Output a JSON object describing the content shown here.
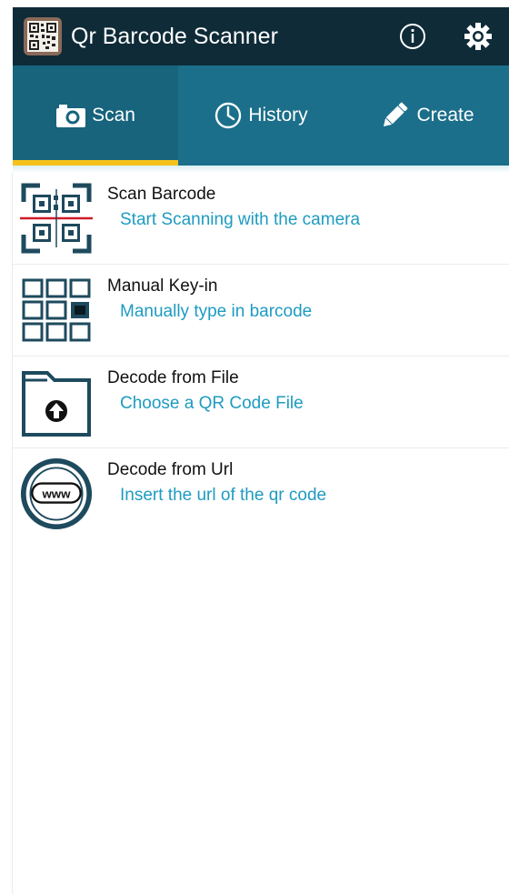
{
  "app": {
    "title": "Qr Barcode Scanner",
    "icons": {
      "app_logo": "qr-code-logo-icon",
      "info": "info-icon",
      "settings": "gear-icon"
    }
  },
  "tabs": [
    {
      "label": "Scan",
      "icon": "camera-icon",
      "active": true
    },
    {
      "label": "History",
      "icon": "clock-icon",
      "active": false
    },
    {
      "label": "Create",
      "icon": "pencil-icon",
      "active": false
    }
  ],
  "colors": {
    "app_bar": "#0f2b38",
    "tab_bar": "#1b6f8a",
    "tab_indicator": "#f4c21b",
    "subtitle": "#1e9bc0",
    "icon_dark": "#1e4a5e"
  },
  "items": [
    {
      "title": "Scan Barcode",
      "subtitle": "Start Scanning with the camera",
      "icon": "qr-scan-icon"
    },
    {
      "title": "Manual Key-in",
      "subtitle": "Manually type in barcode",
      "icon": "keypad-icon"
    },
    {
      "title": "Decode from File",
      "subtitle": "Choose a QR Code File",
      "icon": "folder-upload-icon"
    },
    {
      "title": "Decode from Url",
      "subtitle": "Insert the url of the qr code",
      "icon": "www-globe-icon"
    }
  ]
}
